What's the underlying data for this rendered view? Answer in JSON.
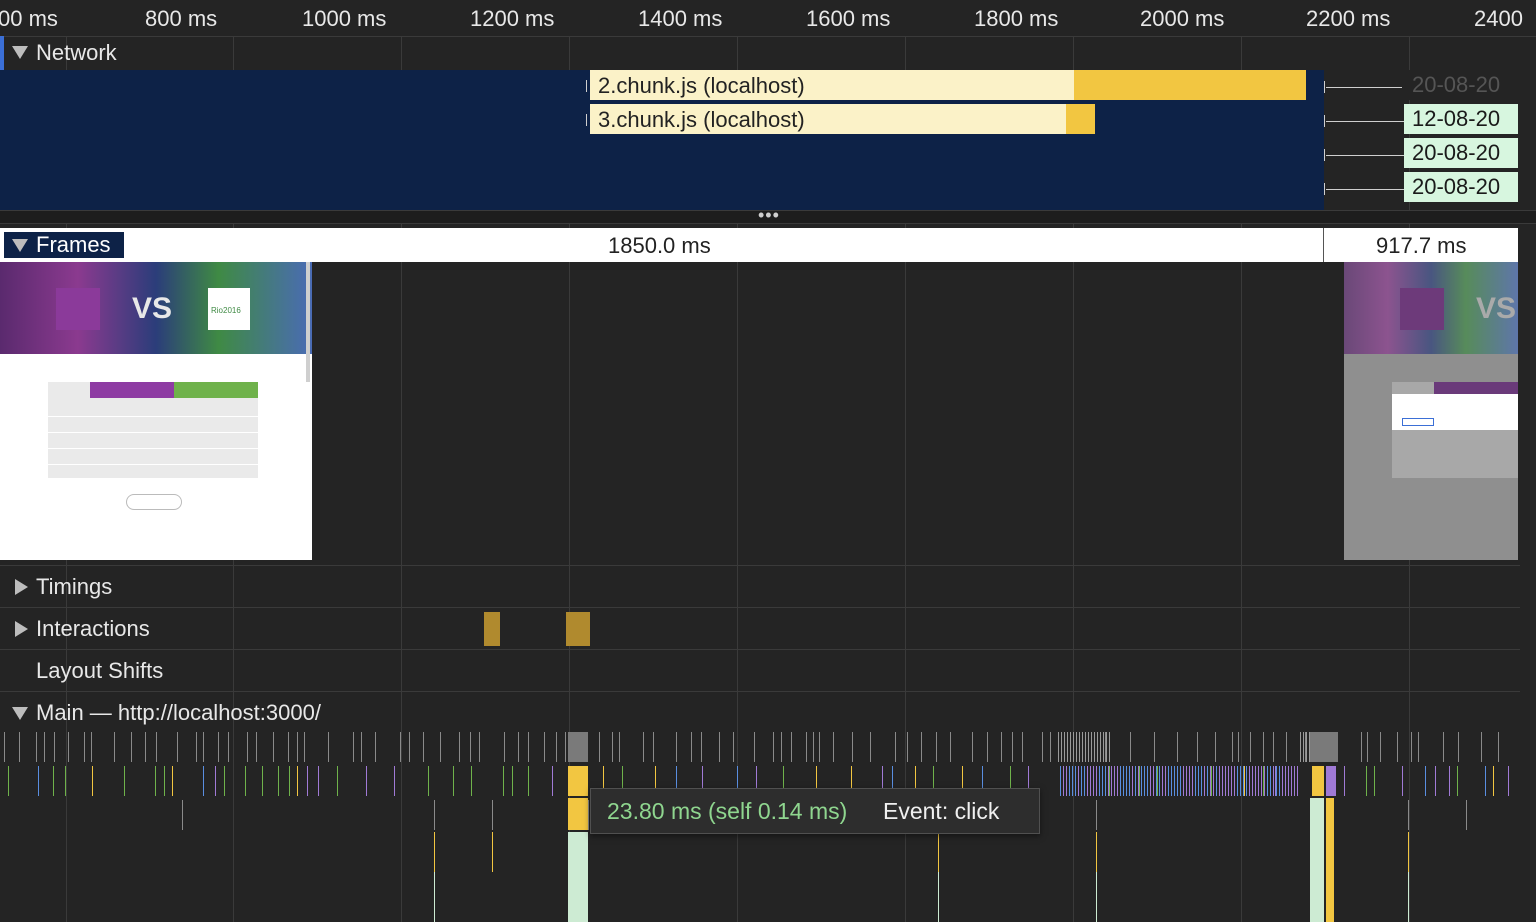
{
  "ruler": {
    "ticks": [
      "00 ms",
      "800 ms",
      "1000 ms",
      "1200 ms",
      "1400 ms",
      "1600 ms",
      "1800 ms",
      "2000 ms",
      "2200 ms",
      "2400"
    ]
  },
  "network": {
    "title": "Network",
    "requests": [
      "2.chunk.js (localhost)",
      "3.chunk.js (localhost)"
    ],
    "right_labels": [
      "20-08-20",
      "12-08-20",
      "20-08-20",
      "20-08-20"
    ]
  },
  "frames": {
    "title": "Frames",
    "durations": [
      "1850.0 ms",
      "917.7 ms"
    ],
    "screenshot_text": {
      "vs": "VS",
      "rio": "Rio2016"
    }
  },
  "tracks": {
    "timings": "Timings",
    "interactions": "Interactions",
    "layout_shifts": "Layout Shifts",
    "main": "Main — http://localhost:3000/"
  },
  "tooltip": {
    "duration": "23.80 ms (self 0.14 ms)",
    "event": "Event: click"
  },
  "colors": {
    "network_bg": "#0d2247",
    "request_light": "#fbf2c8",
    "request_dark": "#f2c641",
    "green_request": "#d7f6df",
    "interaction": "#b08a2e",
    "scripting": "#f2c641",
    "rendering": "#a07ad6",
    "painting": "#6fb24b",
    "tooltip_green": "#8fd68f"
  }
}
